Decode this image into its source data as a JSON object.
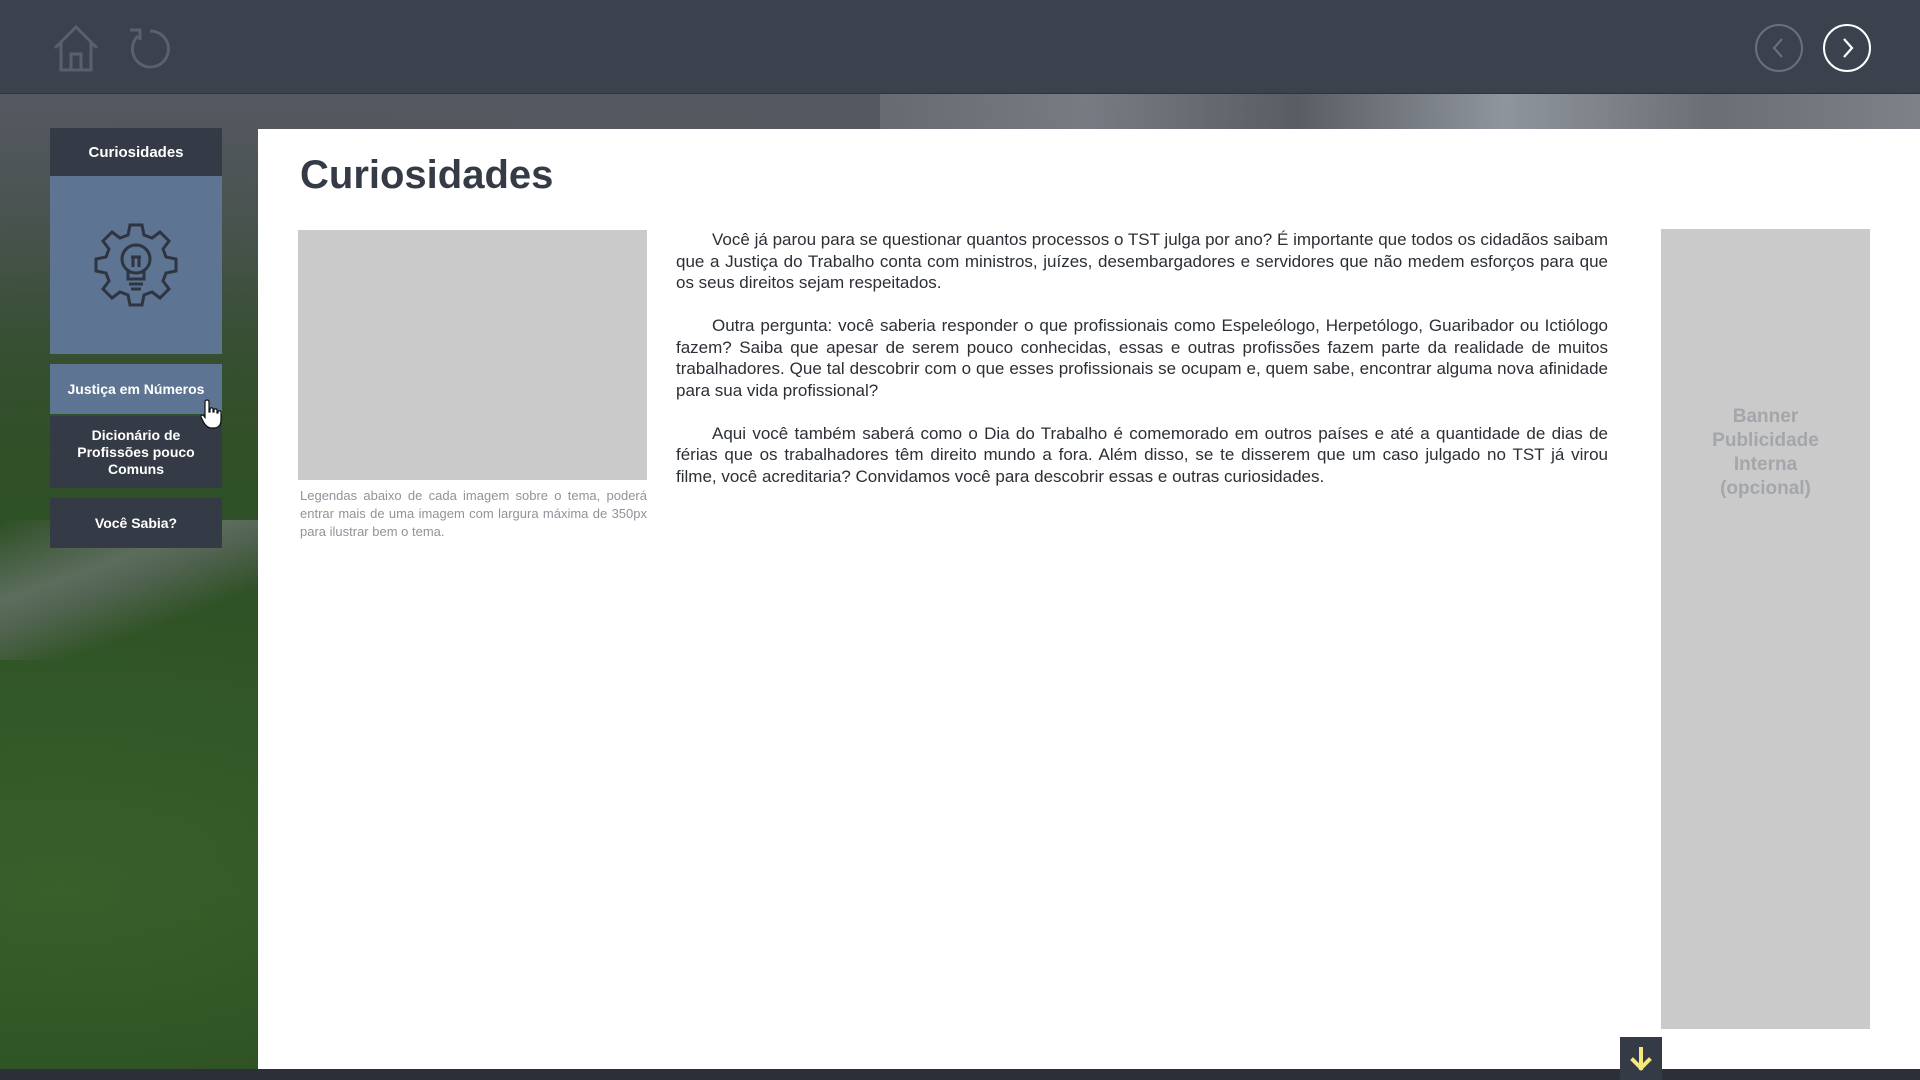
{
  "topbar": {
    "home_icon": "home-icon",
    "reload_icon": "reload-icon",
    "prev_icon": "chevron-left-icon",
    "next_icon": "chevron-right-icon"
  },
  "sidebar": {
    "header": "Curiosidades",
    "illustration_icon": "gear-lightbulb-icon",
    "items": [
      {
        "label": "Justiça em Números",
        "active": true
      },
      {
        "label": "Dicionário de Profissões pouco Comuns",
        "active": false
      },
      {
        "label": "Você Sabia?",
        "active": false
      }
    ]
  },
  "main": {
    "title": "Curiosidades",
    "image_caption": "Legendas abaixo de cada imagem sobre o tema, poderá entrar mais de uma imagem com largura máxima de 350px para ilustrar bem o tema.",
    "paragraphs": [
      "Você já parou para se questionar quantos processos o TST julga por ano? É importante que todos os cidadãos saibam que a Justiça do Trabalho conta com ministros, juízes, desembargadores e servidores que não medem esforços para que os seus direitos sejam respeitados.",
      "Outra pergunta: você saberia responder o que profissionais como Espeleólogo, Herpetólogo, Guaribador ou Ictiólogo fazem? Saiba que apesar de serem pouco conhecidas, essas e outras profissões fazem parte da realidade de muitos trabalhadores. Que tal descobrir com o que esses profissionais se ocupam e, quem sabe, encontrar alguma nova afinidade para sua vida profissional?",
      "Aqui você também saberá como o Dia do Trabalho é comemorado em outros países e até a quantidade de dias de férias que os trabalhadores têm direito mundo a fora.  Além disso, se te disserem que um caso julgado no TST já virou filme, você acreditaria? Convidamos você para descobrir essas e outras curiosidades."
    ],
    "banner_text": "Banner Publicidade Interna (opcional)"
  },
  "scroll": {
    "icon": "arrow-down-icon"
  },
  "colors": {
    "topbar": "#3b414d",
    "sidebar_dark": "#353b46",
    "sidebar_accent": "#5d7592",
    "placeholder": "#cacaca",
    "scroll_arrow": "#f5e97a"
  }
}
